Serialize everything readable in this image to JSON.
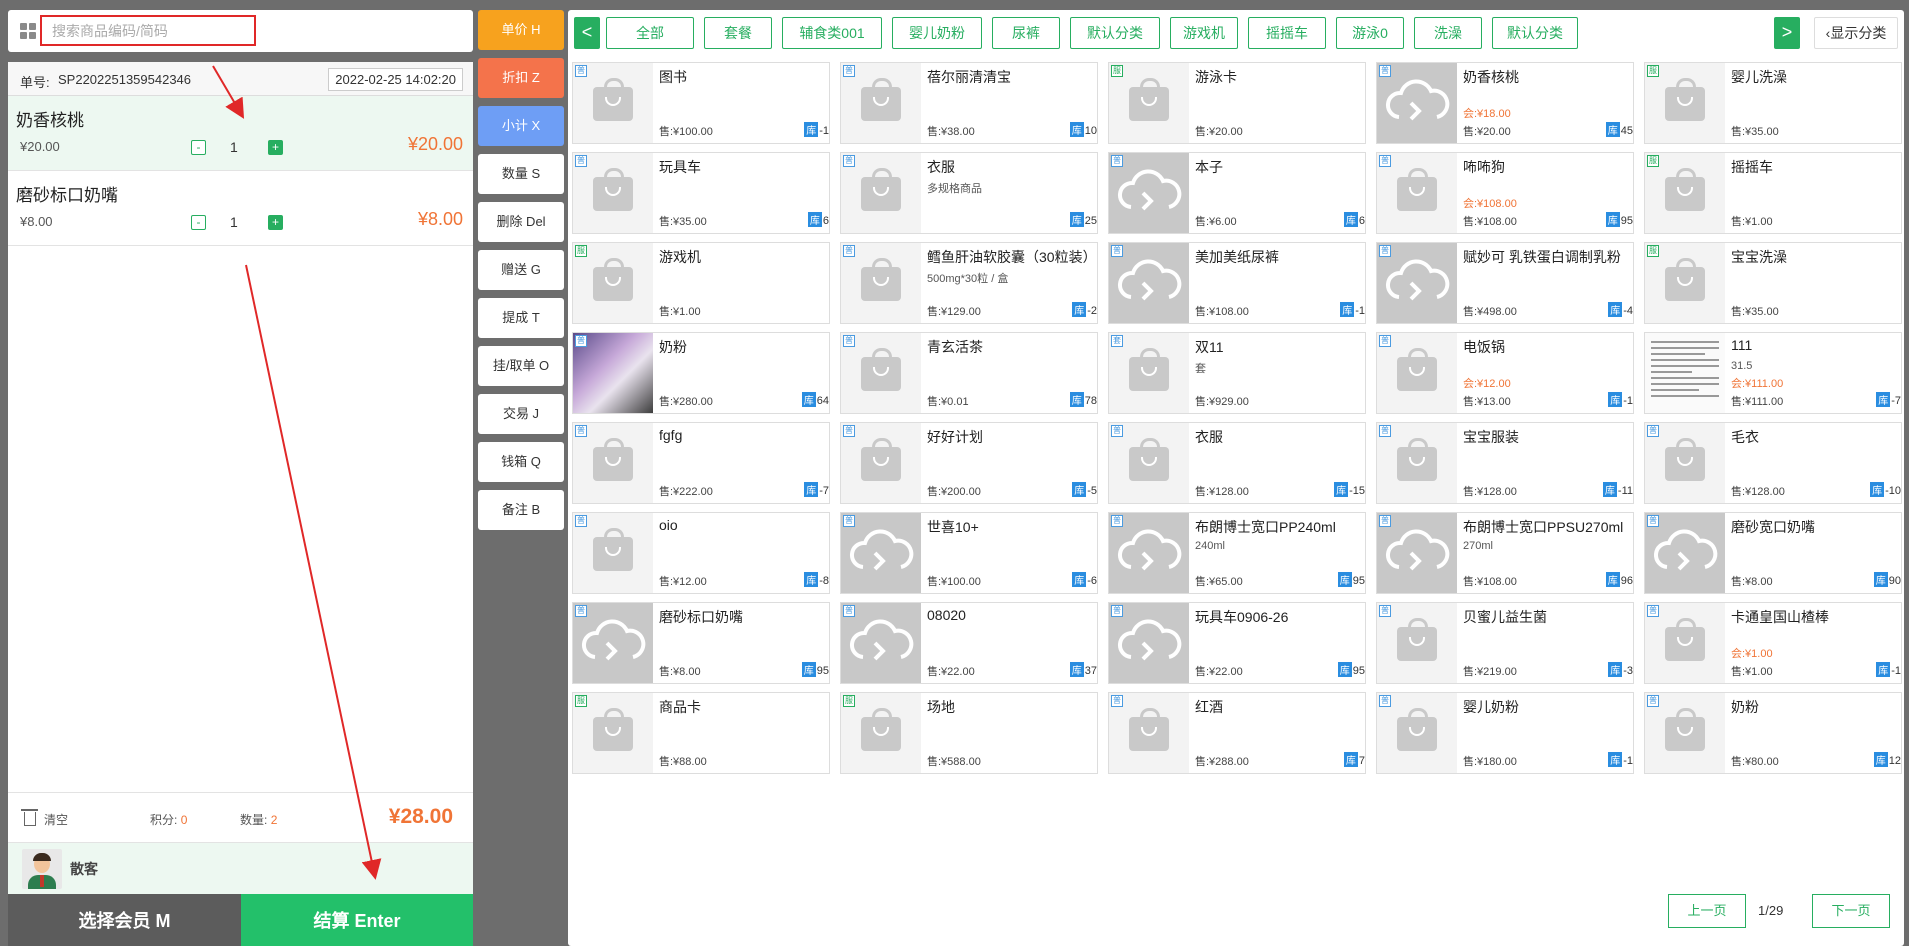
{
  "search": {
    "placeholder": "搜索商品编码/简码"
  },
  "order": {
    "no_label": "单号:",
    "no": "SP2202251359542346",
    "datetime": "2022-02-25 14:02:20",
    "items": [
      {
        "name": "奶香核桃",
        "unit_price": "¥20.00",
        "qty": "1",
        "total": "¥20.00"
      },
      {
        "name": "磨砂标口奶嘴",
        "unit_price": "¥8.00",
        "qty": "1",
        "total": "¥8.00"
      }
    ],
    "minus": "-",
    "plus": "+",
    "clear_label": "清空",
    "points_label": "积分:",
    "points": "0",
    "qty_label": "数量:",
    "qty_total": "2",
    "grand_total": "¥28.00",
    "member_name": "散客",
    "select_member": "选择会员 M",
    "checkout": "结算 Enter"
  },
  "functions": [
    "单价 H",
    "折扣 Z",
    "小计 X",
    "数量 S",
    "删除 Del",
    "赠送 G",
    "提成 T",
    "挂/取单 O",
    "交易 J",
    "钱箱 Q",
    "备注 B"
  ],
  "categories": {
    "prev": "<",
    "next": ">",
    "items": [
      "全部",
      "套餐",
      "辅食类001",
      "婴儿奶粉",
      "尿裤",
      "默认分类",
      "游戏机",
      "摇摇车",
      "游泳0",
      "洗澡",
      "默认分类"
    ],
    "show_label": "显示分类"
  },
  "products": [
    {
      "badge": "普",
      "thumb": "bag",
      "name": "图书",
      "price": "售:¥100.00",
      "stock_label": "库",
      "stock": "-1"
    },
    {
      "badge": "普",
      "thumb": "bag",
      "name": "蓓尔丽清清宝",
      "price": "售:¥38.00",
      "stock_label": "库",
      "stock": "10"
    },
    {
      "badge": "服",
      "thumb": "bag",
      "name": "游泳卡",
      "price": "售:¥20.00",
      "stock_label": "",
      "stock": ""
    },
    {
      "badge": "普",
      "thumb": "cloud",
      "name": "奶香核桃",
      "member": "会:¥18.00",
      "price": "售:¥20.00",
      "stock_label": "库",
      "stock": "45"
    },
    {
      "badge": "服",
      "thumb": "bag",
      "name": "婴儿洗澡",
      "price": "售:¥35.00",
      "stock_label": "",
      "stock": ""
    },
    {
      "badge": "普",
      "thumb": "bag",
      "name": "玩具车",
      "price": "售:¥35.00",
      "stock_label": "库",
      "stock": "6"
    },
    {
      "badge": "普",
      "thumb": "bag",
      "name": "衣服",
      "sub": "多规格商品",
      "price": "",
      "stock_label": "库",
      "stock": "25"
    },
    {
      "badge": "普",
      "thumb": "cloud",
      "name": "本子",
      "price": "售:¥6.00",
      "stock_label": "库",
      "stock": "6"
    },
    {
      "badge": "普",
      "thumb": "bag",
      "name": "咘咘狗",
      "member": "会:¥108.00",
      "price": "售:¥108.00",
      "stock_label": "库",
      "stock": "95"
    },
    {
      "badge": "服",
      "thumb": "bag",
      "name": "摇摇车",
      "price": "售:¥1.00",
      "stock_label": "",
      "stock": ""
    },
    {
      "badge": "服",
      "thumb": "bag",
      "name": "游戏机",
      "price": "售:¥1.00",
      "stock_label": "",
      "stock": ""
    },
    {
      "badge": "普",
      "thumb": "bag",
      "name": "鳕鱼肝油软胶囊（30粒装）",
      "sub": "500mg*30粒 / 盒",
      "price": "售:¥129.00",
      "stock_label": "库",
      "stock": "-2"
    },
    {
      "badge": "普",
      "thumb": "cloud",
      "name": "美加美纸尿裤",
      "price": "售:¥108.00",
      "stock_label": "库",
      "stock": "-1"
    },
    {
      "badge": "普",
      "thumb": "cloud",
      "name": "赋妙可 乳铁蛋白调制乳粉",
      "price": "售:¥498.00",
      "stock_label": "库",
      "stock": "-4"
    },
    {
      "badge": "服",
      "thumb": "bag",
      "name": "宝宝洗澡",
      "price": "售:¥35.00",
      "stock_label": "",
      "stock": ""
    },
    {
      "badge": "普",
      "thumb": "photo",
      "name": "奶粉",
      "price": "售:¥280.00",
      "stock_label": "库",
      "stock": "64"
    },
    {
      "badge": "普",
      "thumb": "bag",
      "name": "青玄活茶",
      "price": "售:¥0.01",
      "stock_label": "库",
      "stock": "78"
    },
    {
      "badge": "套",
      "thumb": "bag",
      "name": "双11",
      "sub": "套",
      "price": "售:¥929.00",
      "stock_label": "",
      "stock": ""
    },
    {
      "badge": "普",
      "thumb": "bag",
      "name": "电饭锅",
      "member": "会:¥12.00",
      "price": "售:¥13.00",
      "stock_label": "库",
      "stock": "-1"
    },
    {
      "badge": "",
      "thumb": "doc",
      "name": "111",
      "sub": "31.5",
      "member": "会:¥111.00",
      "price": "售:¥111.00",
      "stock_label": "库",
      "stock": "-7"
    },
    {
      "badge": "普",
      "thumb": "bag",
      "name": "fgfg",
      "price": "售:¥222.00",
      "stock_label": "库",
      "stock": "-7"
    },
    {
      "badge": "普",
      "thumb": "bag",
      "name": "好好计划",
      "price": "售:¥200.00",
      "stock_label": "库",
      "stock": "-5"
    },
    {
      "badge": "普",
      "thumb": "bag",
      "name": "衣服",
      "price": "售:¥128.00",
      "stock_label": "库",
      "stock": "-15"
    },
    {
      "badge": "普",
      "thumb": "bag",
      "name": "宝宝服装",
      "price": "售:¥128.00",
      "stock_label": "库",
      "stock": "-11"
    },
    {
      "badge": "普",
      "thumb": "bag",
      "name": "毛衣",
      "price": "售:¥128.00",
      "stock_label": "库",
      "stock": "-10"
    },
    {
      "badge": "普",
      "thumb": "bag",
      "name": "oio",
      "price": "售:¥12.00",
      "stock_label": "库",
      "stock": "-8"
    },
    {
      "badge": "普",
      "thumb": "cloud",
      "name": "世喜10+",
      "price": "售:¥100.00",
      "stock_label": "库",
      "stock": "-6"
    },
    {
      "badge": "普",
      "thumb": "cloud",
      "name": "布朗博士宽口PP240ml",
      "sub": "240ml",
      "price": "售:¥65.00",
      "stock_label": "库",
      "stock": "95"
    },
    {
      "badge": "普",
      "thumb": "cloud",
      "name": "布朗博士宽口PPSU270ml",
      "sub": "270ml",
      "price": "售:¥108.00",
      "stock_label": "库",
      "stock": "96"
    },
    {
      "badge": "普",
      "thumb": "cloud",
      "name": "磨砂宽口奶嘴",
      "price": "售:¥8.00",
      "stock_label": "库",
      "stock": "90"
    },
    {
      "badge": "普",
      "thumb": "cloud",
      "name": "磨砂标口奶嘴",
      "price": "售:¥8.00",
      "stock_label": "库",
      "stock": "95"
    },
    {
      "badge": "普",
      "thumb": "cloud",
      "name": "08020",
      "price": "售:¥22.00",
      "stock_label": "库",
      "stock": "37"
    },
    {
      "badge": "普",
      "thumb": "cloud",
      "name": "玩具车0906-26",
      "price": "售:¥22.00",
      "stock_label": "库",
      "stock": "95"
    },
    {
      "badge": "普",
      "thumb": "bag",
      "name": "贝蜜儿益生菌",
      "price": "售:¥219.00",
      "stock_label": "库",
      "stock": "-3"
    },
    {
      "badge": "普",
      "thumb": "bag",
      "name": "卡通皇国山楂棒",
      "member": "会:¥1.00",
      "price": "售:¥1.00",
      "stock_label": "库",
      "stock": "-1"
    },
    {
      "badge": "服",
      "thumb": "bag",
      "name": "商品卡",
      "price": "售:¥88.00",
      "stock_label": "",
      "stock": ""
    },
    {
      "badge": "服",
      "thumb": "bag",
      "name": "场地",
      "price": "售:¥588.00",
      "stock_label": "",
      "stock": ""
    },
    {
      "badge": "普",
      "thumb": "bag",
      "name": "红酒",
      "price": "售:¥288.00",
      "stock_label": "库",
      "stock": "7"
    },
    {
      "badge": "普",
      "thumb": "bag",
      "name": "婴儿奶粉",
      "price": "售:¥180.00",
      "stock_label": "库",
      "stock": "-1"
    },
    {
      "badge": "普",
      "thumb": "bag",
      "name": "奶粉",
      "price": "售:¥80.00",
      "stock_label": "库",
      "stock": "12"
    }
  ],
  "pagination": {
    "prev": "上一页",
    "page": "1/29",
    "next": "下一页"
  },
  "colors": {
    "accent": "#23c06a",
    "price": "#f07436",
    "annotation": "#e02828"
  }
}
